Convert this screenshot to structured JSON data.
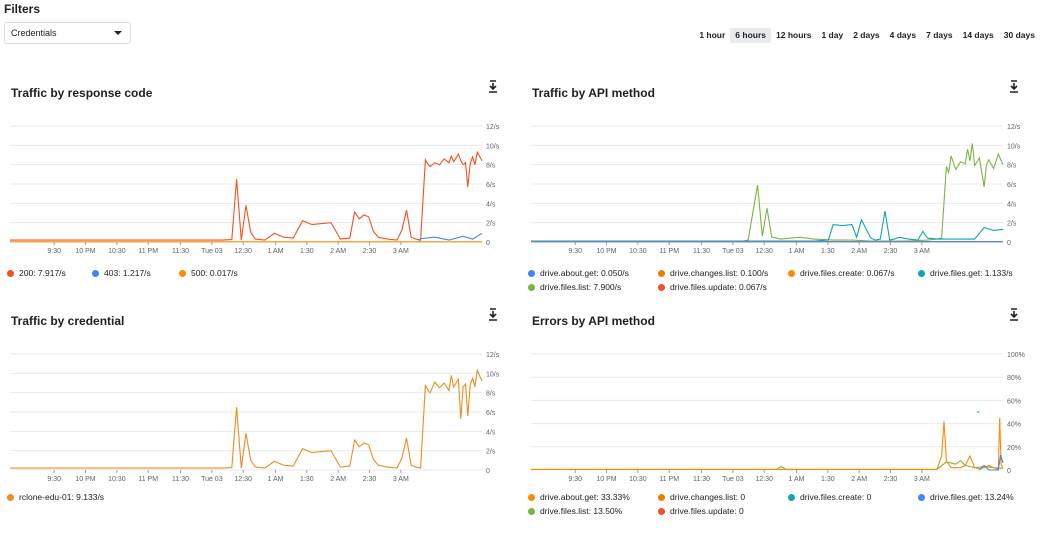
{
  "filters": {
    "title": "Filters",
    "credential_select": "Credentials",
    "ranges": [
      "1 hour",
      "6 hours",
      "12 hours",
      "1 day",
      "2 days",
      "4 days",
      "7 days",
      "14 days",
      "30 days"
    ],
    "active_range": "6 hours"
  },
  "icons": {
    "download": "download-icon",
    "dropdown": "chevron-down-icon"
  },
  "x_ticks": [
    "9:30",
    "10 PM",
    "10:30",
    "11 PM",
    "11:30",
    "Tue 03",
    "12:30",
    "1 AM",
    "1:30",
    "2 AM",
    "2:30",
    "3 AM"
  ],
  "cards": [
    {
      "title": "Traffic by response code",
      "legend": [
        {
          "label": "200: 7.917/s",
          "color": "#f4511e"
        },
        {
          "label": "403: 1.217/s",
          "color": "#4285f4"
        },
        {
          "label": "500: 0.017/s",
          "color": "#fb8c00"
        }
      ]
    },
    {
      "title": "Traffic by API method",
      "legend": [
        {
          "label": "drive.about.get: 0.050/s",
          "color": "#4285f4"
        },
        {
          "label": "drive.changes.list: 0.100/s",
          "color": "#f57c00"
        },
        {
          "label": "drive.files.create: 0.067/s",
          "color": "#fb8c00"
        },
        {
          "label": "drive.files.get: 1.133/s",
          "color": "#12a4af"
        },
        {
          "label": "drive.files.list: 7.900/s",
          "color": "#7cb342"
        },
        {
          "label": "drive.files.update: 0.067/s",
          "color": "#f4511e"
        }
      ]
    },
    {
      "title": "Traffic by credential",
      "legend": [
        {
          "label": "rclone-edu-01: 9.133/s",
          "color": "#f08c1e"
        }
      ]
    },
    {
      "title": "Errors by API method",
      "legend": [
        {
          "label": "drive.about.get: 33.33%",
          "color": "#fb8c00"
        },
        {
          "label": "drive.changes.list: 0",
          "color": "#f57c00"
        },
        {
          "label": "drive.files.create: 0",
          "color": "#12a4af"
        },
        {
          "label": "drive.files.get: 13.24%",
          "color": "#4285f4"
        },
        {
          "label": "drive.files.list: 13.50%",
          "color": "#7cb342"
        },
        {
          "label": "drive.files.update: 0",
          "color": "#f4511e"
        }
      ]
    }
  ],
  "chart_data": [
    {
      "type": "line",
      "title": "Traffic by response code",
      "yticks": [
        "12/s",
        "10/s",
        "8/s",
        "6/s",
        "4/s",
        "2/s",
        "0"
      ],
      "ylim": [
        0,
        12
      ],
      "xlim": [
        0,
        1
      ],
      "series": [
        {
          "name": "200",
          "color": "#f4511e",
          "points": [
            [
              0,
              0.2
            ],
            [
              0.45,
              0.2
            ],
            [
              0.47,
              0.25
            ],
            [
              0.48,
              6.5
            ],
            [
              0.49,
              0.2
            ],
            [
              0.5,
              3.8
            ],
            [
              0.51,
              1.0
            ],
            [
              0.52,
              0.3
            ],
            [
              0.54,
              0.2
            ],
            [
              0.56,
              0.9
            ],
            [
              0.58,
              0.5
            ],
            [
              0.6,
              0.4
            ],
            [
              0.62,
              2.2
            ],
            [
              0.64,
              1.8
            ],
            [
              0.66,
              1.9
            ],
            [
              0.68,
              2.0
            ],
            [
              0.7,
              0.3
            ],
            [
              0.72,
              0.4
            ],
            [
              0.73,
              3.1
            ],
            [
              0.74,
              2.4
            ],
            [
              0.75,
              2.8
            ],
            [
              0.76,
              2.6
            ],
            [
              0.77,
              1.1
            ],
            [
              0.78,
              0.5
            ],
            [
              0.8,
              0.3
            ],
            [
              0.82,
              0.2
            ],
            [
              0.83,
              1.2
            ],
            [
              0.84,
              3.3
            ],
            [
              0.85,
              0.5
            ],
            [
              0.86,
              0.3
            ],
            [
              0.87,
              0.2
            ],
            [
              0.88,
              8.5
            ],
            [
              0.885,
              8.1
            ],
            [
              0.89,
              7.8
            ],
            [
              0.9,
              8.2
            ],
            [
              0.91,
              8.0
            ],
            [
              0.92,
              8.6
            ],
            [
              0.93,
              8.2
            ],
            [
              0.935,
              8.9
            ],
            [
              0.94,
              8.3
            ],
            [
              0.95,
              9.1
            ],
            [
              0.955,
              8.4
            ],
            [
              0.96,
              8.0
            ],
            [
              0.965,
              8.2
            ],
            [
              0.97,
              5.7
            ],
            [
              0.975,
              8.1
            ],
            [
              0.98,
              8.8
            ],
            [
              0.985,
              8.0
            ],
            [
              0.99,
              9.3
            ],
            [
              1.0,
              8.4
            ]
          ]
        },
        {
          "name": "403",
          "color": "#4285f4",
          "points": [
            [
              0.865,
              0.0
            ],
            [
              0.87,
              0.35
            ],
            [
              0.9,
              0.5
            ],
            [
              0.93,
              0.2
            ],
            [
              0.96,
              0.6
            ],
            [
              0.98,
              0.3
            ],
            [
              1.0,
              0.9
            ]
          ]
        },
        {
          "name": "500",
          "color": "#fb8c00",
          "points": [
            [
              0,
              0.02
            ],
            [
              1.0,
              0.02
            ]
          ]
        }
      ]
    },
    {
      "type": "line",
      "title": "Traffic by API method",
      "yticks": [
        "12/s",
        "10/s",
        "8/s",
        "6/s",
        "4/s",
        "2/s",
        "0"
      ],
      "ylim": [
        0,
        12
      ],
      "xlim": [
        0,
        1
      ],
      "series": [
        {
          "name": "drive.files.list",
          "color": "#7cb342",
          "points": [
            [
              0,
              0.1
            ],
            [
              0.45,
              0.1
            ],
            [
              0.46,
              0.2
            ],
            [
              0.48,
              5.9
            ],
            [
              0.49,
              0.6
            ],
            [
              0.5,
              3.5
            ],
            [
              0.51,
              0.5
            ],
            [
              0.53,
              0.3
            ],
            [
              0.57,
              0.5
            ],
            [
              0.6,
              0.3
            ],
            [
              0.64,
              0.2
            ],
            [
              0.68,
              0.2
            ],
            [
              0.72,
              0.1
            ],
            [
              0.76,
              0.1
            ],
            [
              0.8,
              0.1
            ],
            [
              0.84,
              0.2
            ],
            [
              0.86,
              0.3
            ],
            [
              0.87,
              0.4
            ],
            [
              0.88,
              7.8
            ],
            [
              0.885,
              7.2
            ],
            [
              0.89,
              8.9
            ],
            [
              0.9,
              7.5
            ],
            [
              0.91,
              8.3
            ],
            [
              0.92,
              8.1
            ],
            [
              0.925,
              9.6
            ],
            [
              0.93,
              8.4
            ],
            [
              0.935,
              10.2
            ],
            [
              0.94,
              7.9
            ],
            [
              0.95,
              8.7
            ],
            [
              0.96,
              5.7
            ],
            [
              0.965,
              8.0
            ],
            [
              0.97,
              8.5
            ],
            [
              0.98,
              7.6
            ],
            [
              0.99,
              9.1
            ],
            [
              1.0,
              8.0
            ]
          ]
        },
        {
          "name": "drive.files.get",
          "color": "#12a4af",
          "points": [
            [
              0.0,
              0.1
            ],
            [
              0.6,
              0.1
            ],
            [
              0.63,
              0.2
            ],
            [
              0.64,
              1.8
            ],
            [
              0.66,
              1.7
            ],
            [
              0.68,
              1.8
            ],
            [
              0.69,
              0.5
            ],
            [
              0.7,
              2.3
            ],
            [
              0.72,
              0.4
            ],
            [
              0.73,
              0.2
            ],
            [
              0.74,
              0.3
            ],
            [
              0.75,
              3.2
            ],
            [
              0.76,
              0.2
            ],
            [
              0.77,
              0.3
            ],
            [
              0.78,
              0.5
            ],
            [
              0.8,
              0.3
            ],
            [
              0.82,
              0.2
            ],
            [
              0.83,
              1.1
            ],
            [
              0.84,
              0.4
            ],
            [
              0.86,
              0.3
            ],
            [
              0.94,
              0.3
            ],
            [
              0.96,
              1.5
            ],
            [
              0.98,
              1.2
            ],
            [
              1.0,
              1.3
            ]
          ]
        },
        {
          "name": "drive.changes.list",
          "color": "#f57c00",
          "points": [
            [
              0,
              0.05
            ],
            [
              1.0,
              0.05
            ]
          ]
        },
        {
          "name": "drive.about.get",
          "color": "#4285f4",
          "points": [
            [
              0,
              0.02
            ],
            [
              1.0,
              0.02
            ]
          ]
        }
      ]
    },
    {
      "type": "line",
      "title": "Traffic by credential",
      "yticks": [
        "12/s",
        "10/s",
        "8/s",
        "6/s",
        "4/s",
        "2/s",
        "0"
      ],
      "ylim": [
        0,
        12
      ],
      "xlim": [
        0,
        1
      ],
      "series": [
        {
          "name": "rclone-edu-01",
          "color": "#f08c1e",
          "points": [
            [
              0,
              0.2
            ],
            [
              0.45,
              0.2
            ],
            [
              0.47,
              0.25
            ],
            [
              0.48,
              6.5
            ],
            [
              0.49,
              0.2
            ],
            [
              0.5,
              3.8
            ],
            [
              0.51,
              1.0
            ],
            [
              0.52,
              0.3
            ],
            [
              0.54,
              0.2
            ],
            [
              0.56,
              0.9
            ],
            [
              0.58,
              0.5
            ],
            [
              0.6,
              0.4
            ],
            [
              0.62,
              2.2
            ],
            [
              0.64,
              1.8
            ],
            [
              0.66,
              1.9
            ],
            [
              0.68,
              2.0
            ],
            [
              0.7,
              0.3
            ],
            [
              0.72,
              0.4
            ],
            [
              0.73,
              3.1
            ],
            [
              0.74,
              2.4
            ],
            [
              0.75,
              2.8
            ],
            [
              0.76,
              2.6
            ],
            [
              0.77,
              1.1
            ],
            [
              0.78,
              0.5
            ],
            [
              0.8,
              0.3
            ],
            [
              0.82,
              0.2
            ],
            [
              0.83,
              1.2
            ],
            [
              0.84,
              3.3
            ],
            [
              0.85,
              0.5
            ],
            [
              0.86,
              0.3
            ],
            [
              0.87,
              0.2
            ],
            [
              0.88,
              8.8
            ],
            [
              0.885,
              8.3
            ],
            [
              0.89,
              8.0
            ],
            [
              0.9,
              9.1
            ],
            [
              0.91,
              8.5
            ],
            [
              0.92,
              9.0
            ],
            [
              0.93,
              8.2
            ],
            [
              0.935,
              9.8
            ],
            [
              0.94,
              8.6
            ],
            [
              0.95,
              9.4
            ],
            [
              0.955,
              5.3
            ],
            [
              0.96,
              8.6
            ],
            [
              0.965,
              8.9
            ],
            [
              0.97,
              5.6
            ],
            [
              0.975,
              8.8
            ],
            [
              0.98,
              9.5
            ],
            [
              0.985,
              8.6
            ],
            [
              0.99,
              10.3
            ],
            [
              1.0,
              9.2
            ]
          ]
        }
      ]
    },
    {
      "type": "line",
      "title": "Errors by API method",
      "yticks": [
        "100%",
        "80%",
        "60%",
        "40%",
        "20%",
        "0"
      ],
      "ylim": [
        0,
        100
      ],
      "xlim": [
        0,
        1
      ],
      "series": [
        {
          "name": "drive.files.list",
          "color": "#7cb342",
          "points": [
            [
              0,
              0.5
            ],
            [
              0.52,
              0.5
            ],
            [
              0.53,
              3.0
            ],
            [
              0.54,
              0.5
            ],
            [
              0.86,
              0.5
            ],
            [
              0.88,
              7.0
            ],
            [
              0.9,
              5.0
            ],
            [
              0.91,
              8.0
            ],
            [
              0.92,
              4.0
            ],
            [
              0.94,
              2.0
            ],
            [
              0.96,
              3.0
            ],
            [
              0.98,
              2.0
            ],
            [
              1.0,
              1.5
            ]
          ]
        },
        {
          "name": "drive.about.get",
          "color": "#fb8c00",
          "points": [
            [
              0,
              0.5
            ],
            [
              0.86,
              0.5
            ],
            [
              0.87,
              12
            ],
            [
              0.875,
              42
            ],
            [
              0.88,
              8
            ],
            [
              0.89,
              2
            ],
            [
              0.91,
              2
            ],
            [
              0.92,
              4
            ],
            [
              0.93,
              12
            ],
            [
              0.94,
              2
            ],
            [
              0.95,
              1
            ],
            [
              0.96,
              2
            ],
            [
              0.97,
              4
            ],
            [
              0.98,
              2
            ],
            [
              0.99,
              0.5
            ],
            [
              0.993,
              45
            ],
            [
              0.996,
              5
            ],
            [
              1.0,
              2
            ]
          ]
        },
        {
          "name": "drive.files.get",
          "color": "#4285f4",
          "points": [
            [
              0.95,
              0
            ],
            [
              0.96,
              4
            ],
            [
              0.97,
              0
            ],
            [
              0.99,
              0
            ],
            [
              0.995,
              13
            ],
            [
              1.0,
              6
            ]
          ]
        },
        {
          "name": "drive.files.create",
          "color": "#12a4af",
          "points": [
            [
              0.945,
              50
            ],
            [
              0.95,
              50
            ]
          ]
        }
      ]
    }
  ]
}
